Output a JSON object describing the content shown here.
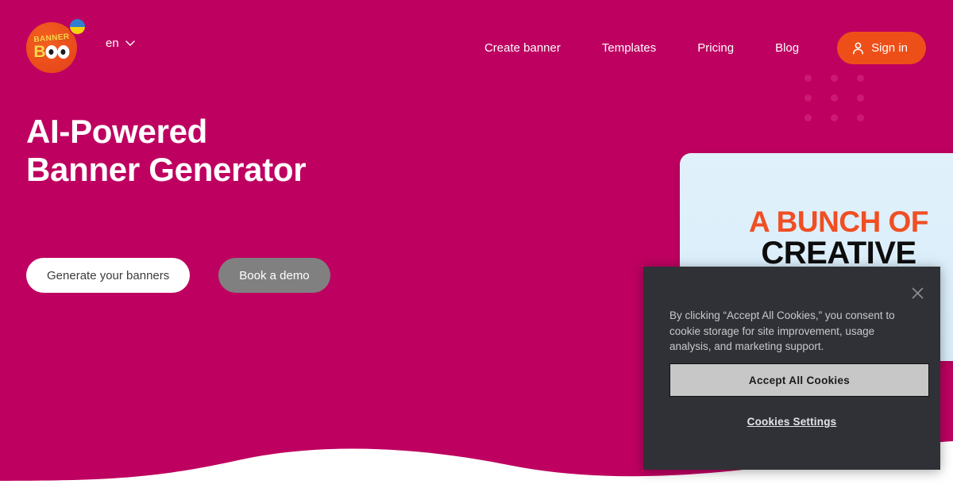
{
  "colors": {
    "background_pink": "#be0060",
    "accent_orange": "#ee4f19",
    "preview_card_bg": "#dcedf9",
    "preview_headline_orange": "#f04e23",
    "secondary_button_gray": "#808080",
    "cookie_dialog_bg": "#303136",
    "cookie_accept_bg": "#c7c7c7",
    "dot_grid": "#cc1a73"
  },
  "header": {
    "logo": {
      "name": "bannerboo-logo",
      "word_top": "BANNER",
      "word_bottom_letter": "B",
      "flag_badge": "ukraine-flag-icon"
    },
    "language": {
      "value": "en",
      "chevron_icon": "chevron-down-icon"
    },
    "nav": [
      {
        "label": "Create banner",
        "name": "nav-create-banner"
      },
      {
        "label": "Templates",
        "name": "nav-templates"
      },
      {
        "label": "Pricing",
        "name": "nav-pricing"
      },
      {
        "label": "Blog",
        "name": "nav-blog"
      }
    ],
    "sign_in": {
      "label": "Sign in",
      "icon": "user-icon"
    }
  },
  "hero": {
    "title_line1": "AI-Powered",
    "title_line2": "Banner Generator",
    "primary_cta": "Generate your banners",
    "secondary_cta": "Book a demo"
  },
  "preview_banner": {
    "line1": "A BUNCH OF",
    "line2": "CREATIVE"
  },
  "cookie_dialog": {
    "close_icon": "close-icon",
    "body": "By clicking “Accept All Cookies,” you consent to cookie storage for site improvement, usage analysis, and marketing support.",
    "accept_label": "Accept All Cookies",
    "settings_label": "Cookies Settings"
  },
  "decor": {
    "dot_count": 9
  }
}
